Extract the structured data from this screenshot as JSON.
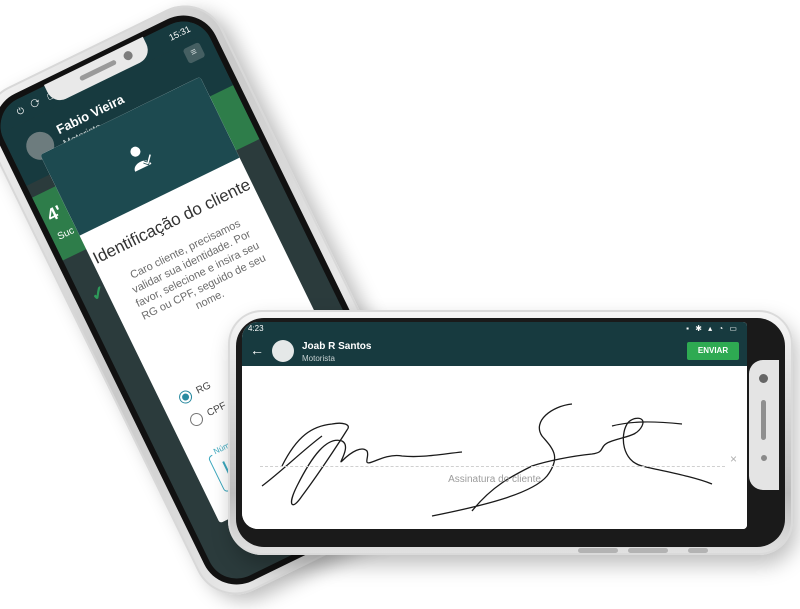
{
  "phone1": {
    "status_time": "15:31",
    "user_name": "Fabio Vieira",
    "user_role": "Motorista",
    "partial_left_text": "4'",
    "partial_left_sub": "Suc",
    "dialog": {
      "title": "Identificação do cliente",
      "text": "Caro cliente, precisamos validar sua identidade. Por favor, selecione e insira seu RG ou CPF, seguido de seu nome.",
      "options": [
        "RG",
        "CPF"
      ],
      "selected": "RG",
      "field_label": "Número do documento"
    }
  },
  "phone2": {
    "status_time": "4:23",
    "user_name": "Joab R Santos",
    "user_role": "Motorista",
    "send_button": "ENVIAR",
    "signature_label": "Assinatura do cliente",
    "clear_icon": "×"
  },
  "colors": {
    "header": "#173a3f",
    "dialog_header": "#1d4a50",
    "accent": "#2eaa52",
    "field_border": "#3aa7bd"
  }
}
